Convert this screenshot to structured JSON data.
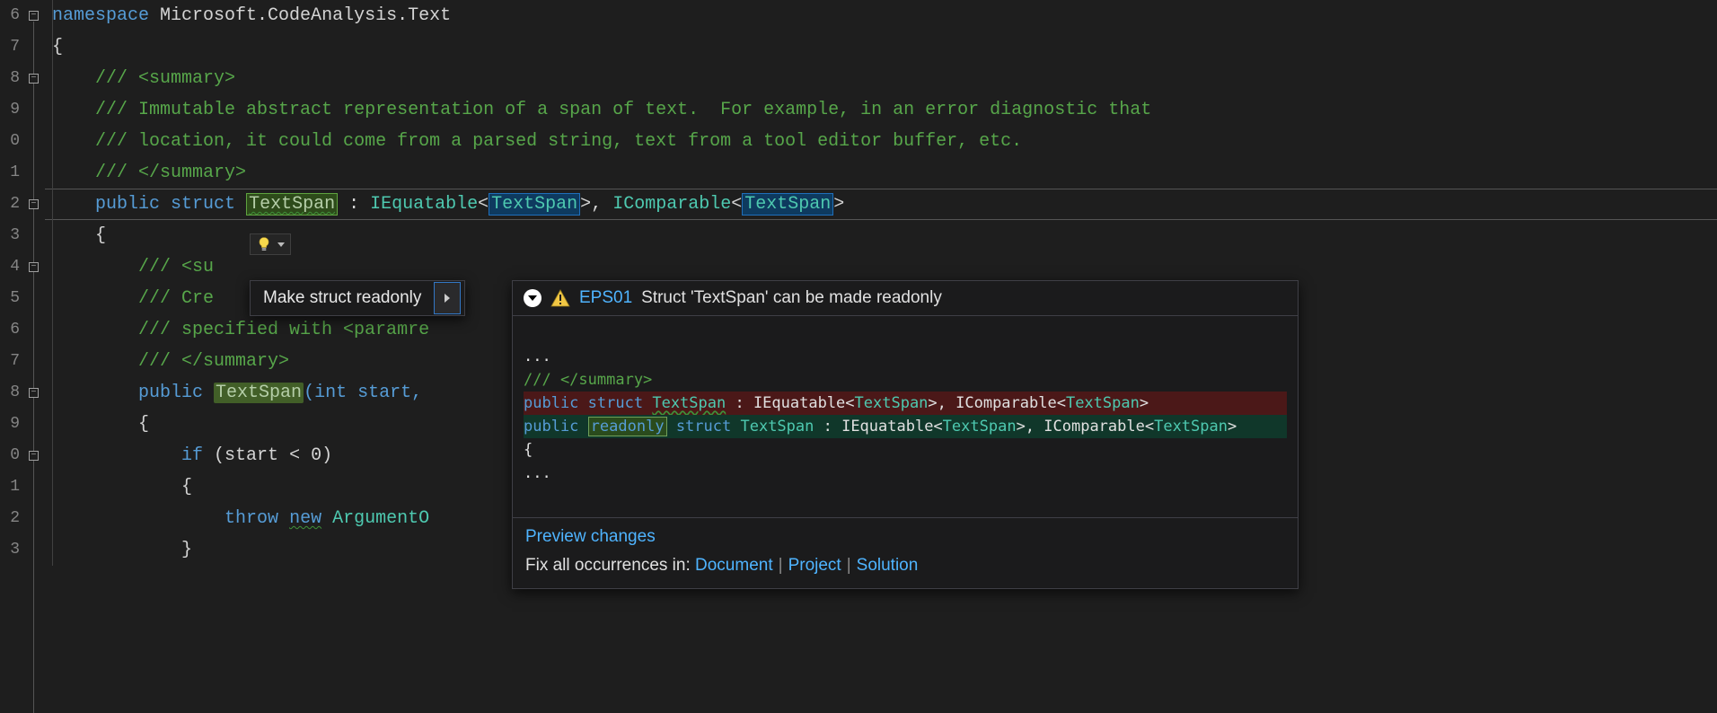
{
  "gutter_lines": [
    "6",
    "7",
    "8",
    "9",
    "0",
    "1",
    "2",
    "3",
    "4",
    "5",
    "6",
    "7",
    "8",
    "9",
    "0",
    "1",
    "2",
    "3"
  ],
  "code": {
    "namespace_kw": "namespace",
    "namespace_name": " Microsoft.CodeAnalysis.Text",
    "brace_open": "{",
    "doc_summary_open": "/// <summary>",
    "doc_line1": "/// Immutable abstract representation of a span of text.  For example, in an error diagnostic that",
    "doc_line2": "/// location, it could come from a parsed string, text from a tool editor buffer, etc.",
    "doc_summary_close": "/// </summary>",
    "public_kw": "public",
    "struct_kw": "struct",
    "struct_name": "TextSpan",
    "colon": " : ",
    "iequatable": "IEquatable",
    "lt": "<",
    "gt": ">",
    "comma": ", ",
    "icomparable": "IComparable",
    "inner_brace_open": "{",
    "inner_doc_su": "/// <su",
    "inner_doc_cre": "/// Cre",
    "inner_doc_spec": "/// specified with <paramre",
    "inner_doc_close": "/// </summary>",
    "ctor_public": "public",
    "ctor_name": "TextSpan",
    "ctor_sig_rest": "(int start,",
    "ctor_brace_open": "{",
    "if_kw": "if",
    "if_cond": " (start < 0)",
    "if_brace_open": "{",
    "throw_kw": "throw",
    "new_kw": "new",
    "argout": " ArgumentO",
    "if_brace_close": "}"
  },
  "lightbulb": {
    "tooltip": "Quick Actions"
  },
  "menu": {
    "item": "Make struct readonly"
  },
  "preview": {
    "rule": "EPS01",
    "message": "Struct 'TextSpan' can be made readonly",
    "ellipsis": "...",
    "summary_close": "/// </summary>",
    "del_line": {
      "public": "public",
      "struct": "struct",
      "name": "TextSpan",
      "rest1": " : IEquatable<",
      "rest2": ">, IComparable<",
      "rest3": ">"
    },
    "add_line": {
      "public": "public",
      "readonly": "readonly",
      "struct": "struct",
      "name": "TextSpan",
      "rest1": " : IEquatable<",
      "rest2": ">, IComparable<",
      "rest3": ">"
    },
    "brace": "{",
    "ellipsis2": "...",
    "preview_changes": "Preview changes",
    "fix_label": "Fix all occurrences in: ",
    "document": "Document",
    "project": "Project",
    "solution": "Solution"
  }
}
